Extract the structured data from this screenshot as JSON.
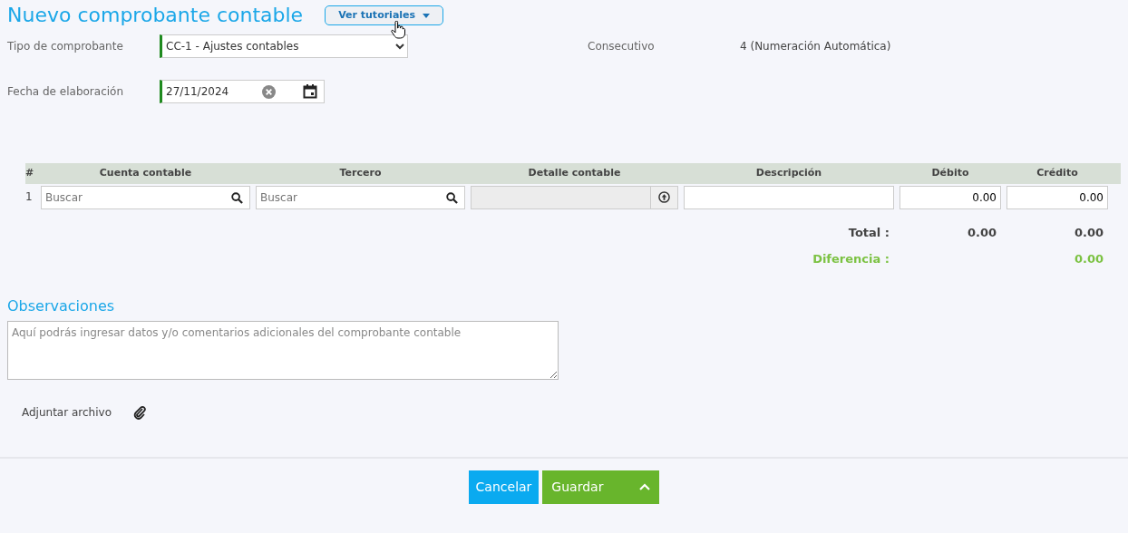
{
  "title": "Nuevo comprobante contable",
  "tutorials_button": "Ver tutoriales",
  "fields": {
    "tipo": {
      "label": "Tipo de comprobante",
      "value": "CC-1 - Ajustes contables"
    },
    "consecutivo": {
      "label": "Consecutivo",
      "value": "4 (Numeración Automática)"
    },
    "fecha": {
      "label": "Fecha de elaboración",
      "value": "27/11/2024"
    }
  },
  "table": {
    "columns": [
      "#",
      "Cuenta contable",
      "Tercero",
      "Detalle contable",
      "Descripción",
      "Débito",
      "Crédito"
    ],
    "rows": [
      {
        "number": "1",
        "cuenta_placeholder": "Buscar",
        "tercero_placeholder": "Buscar",
        "debito": "0.00",
        "credito": "0.00"
      }
    ]
  },
  "totals": {
    "total_label": "Total :",
    "total_debito": "0.00",
    "total_credito": "0.00",
    "diferencia_label": "Diferencia :",
    "diferencia": "0.00"
  },
  "observaciones": {
    "title": "Observaciones",
    "placeholder": "Aquí podrás ingresar datos y/o comentarios adicionales del comprobante contable"
  },
  "attach_label": "Adjuntar archivo",
  "buttons": {
    "cancel": "Cancelar",
    "save": "Guardar"
  }
}
